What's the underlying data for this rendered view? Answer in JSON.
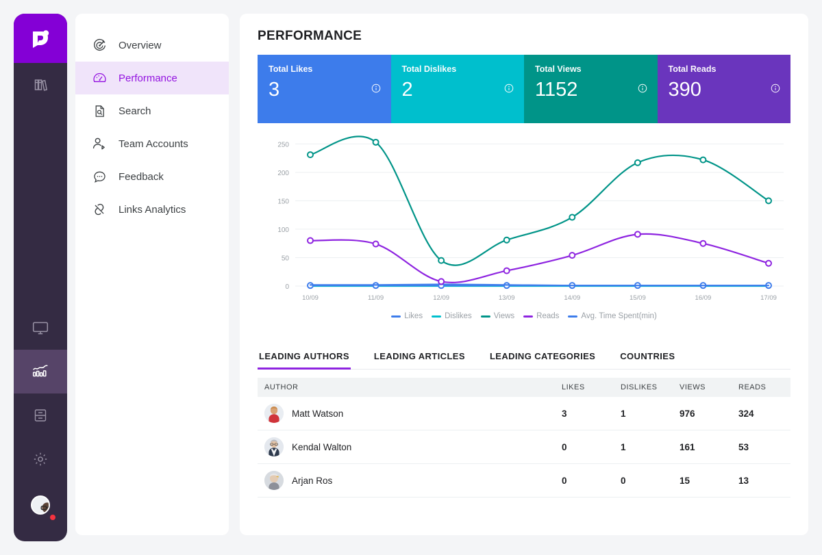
{
  "rail": {
    "logo_icon": "brand-logo-icon",
    "top_items": [
      {
        "icon": "books-library-icon",
        "name": "library"
      }
    ],
    "bottom_items": [
      {
        "icon": "monitor-screen-icon",
        "name": "monitor",
        "active": false
      },
      {
        "icon": "analytics-chart-icon",
        "name": "analytics",
        "active": true
      },
      {
        "icon": "archive-drawer-icon",
        "name": "archive",
        "active": false
      },
      {
        "icon": "gear-settings-icon",
        "name": "settings",
        "active": false
      }
    ],
    "avatar": {
      "name": "user-avatar",
      "badge": true
    }
  },
  "sidebar": {
    "items": [
      {
        "label": "Overview",
        "icon": "target-overview-icon",
        "active": false
      },
      {
        "label": "Performance",
        "icon": "gauge-performance-icon",
        "active": true
      },
      {
        "label": "Search",
        "icon": "document-search-icon",
        "active": false
      },
      {
        "label": "Team Accounts",
        "icon": "person-tag-icon",
        "active": false
      },
      {
        "label": "Feedback",
        "icon": "chat-bubble-icon",
        "active": false
      },
      {
        "label": "Links Analytics",
        "icon": "broken-link-icon",
        "active": false
      }
    ]
  },
  "header": {
    "title": "PERFORMANCE"
  },
  "kpis": [
    {
      "label": "Total Likes",
      "value": "3",
      "color": "#3d7ceb",
      "info_icon": "info-circle-icon"
    },
    {
      "label": "Total Dislikes",
      "value": "2",
      "color": "#00bfcd",
      "info_icon": "info-circle-icon"
    },
    {
      "label": "Total Views",
      "value": "1152",
      "color": "#009488",
      "info_icon": "info-circle-icon"
    },
    {
      "label": "Total Reads",
      "value": "390",
      "color": "#6a35bd",
      "info_icon": "info-circle-icon"
    }
  ],
  "chart_data": {
    "type": "line",
    "title": "",
    "xlabel": "",
    "ylabel": "",
    "grid": true,
    "legend_position": "bottom",
    "categories": [
      "10/09",
      "11/09",
      "12/09",
      "13/09",
      "14/09",
      "15/09",
      "16/09",
      "17/09"
    ],
    "ylim": [
      0,
      260
    ],
    "yticks": [
      0,
      50,
      100,
      150,
      200,
      250
    ],
    "series": [
      {
        "name": "Likes",
        "color": "#3d7ceb",
        "values": [
          2,
          2,
          3,
          2,
          1,
          1,
          1,
          1
        ]
      },
      {
        "name": "Dislikes",
        "color": "#00bfcd",
        "values": [
          0,
          0,
          0,
          0,
          0,
          0,
          0,
          0
        ]
      },
      {
        "name": "Views",
        "color": "#009488",
        "values": [
          231,
          253,
          45,
          81,
          121,
          217,
          222,
          150
        ]
      },
      {
        "name": "Reads",
        "color": "#8e24e0",
        "values": [
          80,
          74,
          8,
          27,
          54,
          91,
          75,
          40
        ]
      },
      {
        "name": "Avg. Time Spent(min)",
        "color": "#3d7ceb",
        "values": [
          1,
          1,
          1,
          1,
          1,
          1,
          1,
          1
        ]
      }
    ]
  },
  "tabs": [
    {
      "label": "LEADING AUTHORS",
      "active": true
    },
    {
      "label": "LEADING ARTICLES",
      "active": false
    },
    {
      "label": "LEADING CATEGORIES",
      "active": false
    },
    {
      "label": "COUNTRIES",
      "active": false
    }
  ],
  "table": {
    "columns": [
      "AUTHOR",
      "LIKES",
      "DISLIKES",
      "VIEWS",
      "READS"
    ],
    "rows": [
      {
        "author": "Matt Watson",
        "likes": "3",
        "dislikes": "1",
        "views": "976",
        "reads": "324"
      },
      {
        "author": "Kendal Walton",
        "likes": "0",
        "dislikes": "1",
        "views": "161",
        "reads": "53"
      },
      {
        "author": "Arjan Ros",
        "likes": "0",
        "dislikes": "0",
        "views": "15",
        "reads": "13"
      }
    ]
  }
}
